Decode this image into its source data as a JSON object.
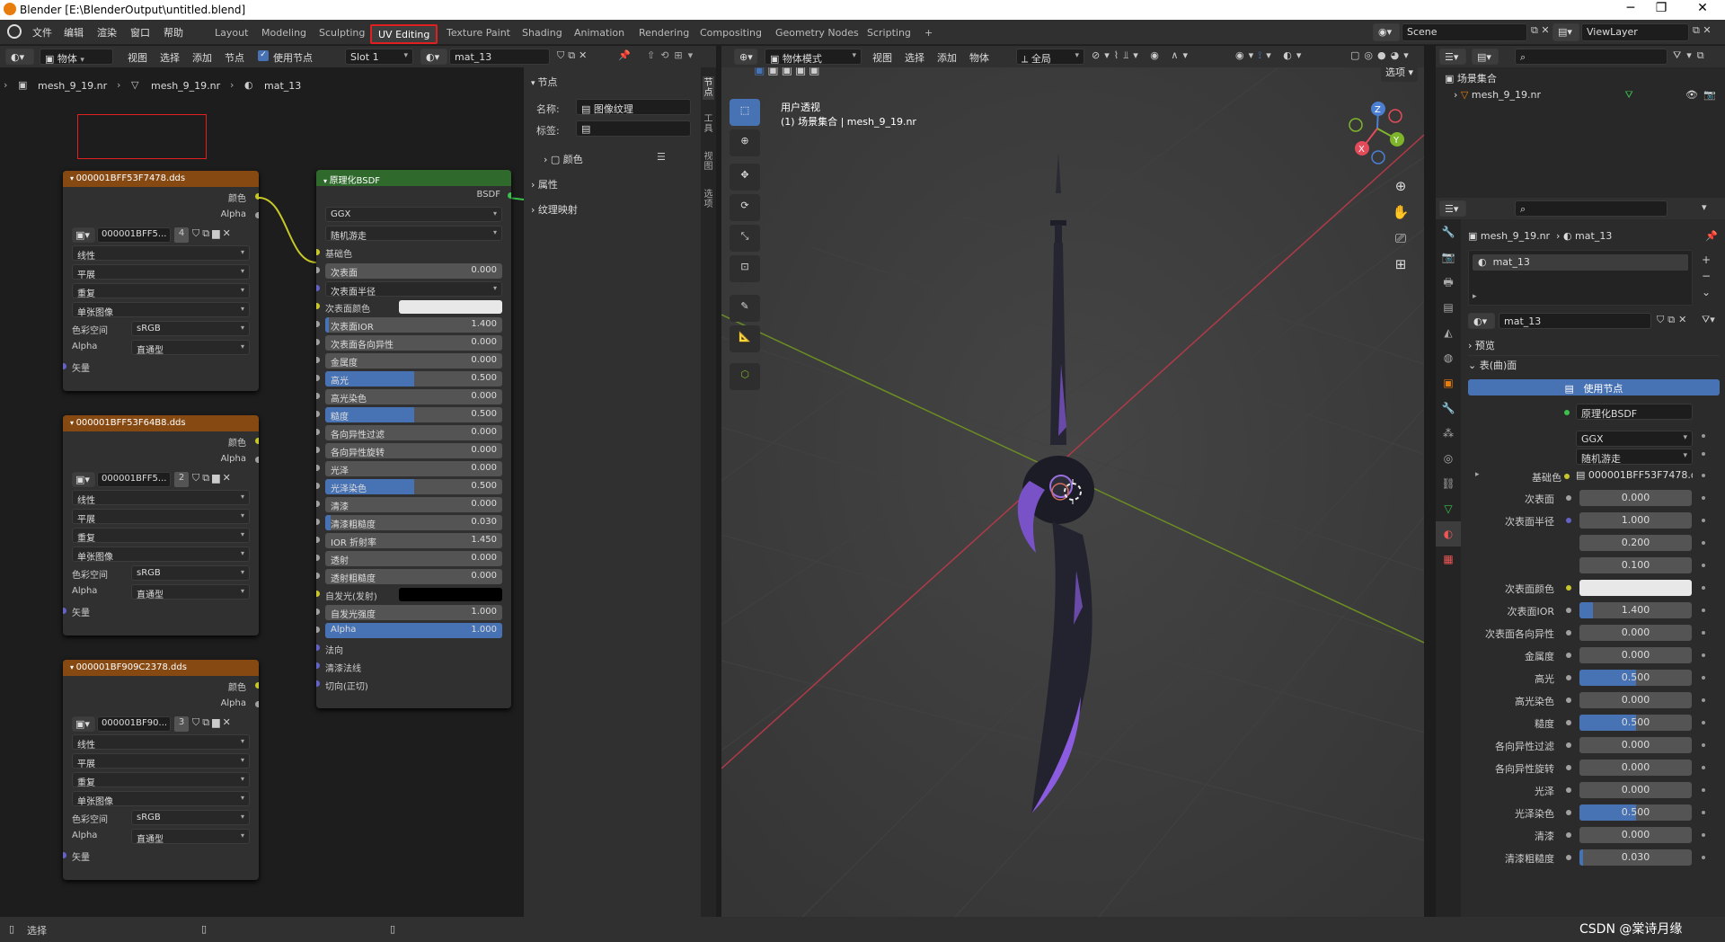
{
  "titlebar": {
    "title": "Blender [E:\\BlenderOutput\\untitled.blend]"
  },
  "menu": [
    "文件",
    "编辑",
    "渲染",
    "窗口",
    "帮助"
  ],
  "workspaces": [
    "Layout",
    "Modeling",
    "Sculpting",
    "UV Editing",
    "Texture Paint",
    "Shading",
    "Animation",
    "Rendering",
    "Compositing",
    "Geometry Nodes",
    "Scripting",
    "+"
  ],
  "active_workspace": "UV Editing",
  "scene": {
    "name": "Scene",
    "view_layer": "ViewLayer"
  },
  "node_header": {
    "mode": "物体",
    "menus": [
      "视图",
      "选择",
      "添加",
      "节点"
    ],
    "use_nodes": "使用节点",
    "slot": "Slot 1",
    "material": "mat_13"
  },
  "breadcrumb": [
    "mesh_9_19.nr",
    "mesh_9_19.nr",
    "mat_13"
  ],
  "image_nodes": [
    {
      "title": "000001BFF53F7478.dds",
      "img": "000001BFF5...",
      "users": "4",
      "interp": "线性",
      "proj": "平展",
      "ext": "重复",
      "src": "单张图像",
      "cs_label": "色彩空间",
      "cs": "sRGB",
      "alpha_label": "Alpha",
      "alpha": "直通型",
      "out_color": "颜色",
      "out_alpha": "Alpha",
      "in_vec": "矢量"
    },
    {
      "title": "000001BFF53F64B8.dds",
      "img": "000001BFF5...",
      "users": "2",
      "interp": "线性",
      "proj": "平展",
      "ext": "重复",
      "src": "单张图像",
      "cs_label": "色彩空间",
      "cs": "sRGB",
      "alpha_label": "Alpha",
      "alpha": "直通型",
      "out_color": "颜色",
      "out_alpha": "Alpha",
      "in_vec": "矢量"
    },
    {
      "title": "000001BF909C2378.dds",
      "img": "000001BF90...",
      "users": "3",
      "interp": "线性",
      "proj": "平展",
      "ext": "重复",
      "src": "单张图像",
      "cs_label": "色彩空间",
      "cs": "sRGB",
      "alpha_label": "Alpha",
      "alpha": "直通型",
      "out_color": "颜色",
      "out_alpha": "Alpha",
      "in_vec": "矢量"
    }
  ],
  "bsdf": {
    "title": "原理化BSDF",
    "output": "BSDF",
    "dist": "GGX",
    "sss_method": "随机游走",
    "base_color": "基础色",
    "fields": [
      {
        "label": "次表面",
        "value": "0.000",
        "fill": 0
      },
      {
        "label": "次表面半径",
        "type": "select"
      },
      {
        "label": "次表面颜色",
        "type": "color",
        "color": "#e8e8e8"
      },
      {
        "label": "次表面IOR",
        "value": "1.400",
        "fill": 0.02
      },
      {
        "label": "次表面各向异性",
        "value": "0.000",
        "fill": 0
      },
      {
        "label": "金属度",
        "value": "0.000",
        "fill": 0
      },
      {
        "label": "高光",
        "value": "0.500",
        "fill": 0.5
      },
      {
        "label": "高光染色",
        "value": "0.000",
        "fill": 0
      },
      {
        "label": "糙度",
        "value": "0.500",
        "fill": 0.5
      },
      {
        "label": "各向异性过滤",
        "value": "0.000",
        "fill": 0
      },
      {
        "label": "各向异性旋转",
        "value": "0.000",
        "fill": 0
      },
      {
        "label": "光泽",
        "value": "0.000",
        "fill": 0
      },
      {
        "label": "光泽染色",
        "value": "0.500",
        "fill": 0.5
      },
      {
        "label": "清漆",
        "value": "0.000",
        "fill": 0
      },
      {
        "label": "清漆粗糙度",
        "value": "0.030",
        "fill": 0.03
      },
      {
        "label": "IOR 折射率",
        "value": "1.450",
        "fill": 0
      },
      {
        "label": "透射",
        "value": "0.000",
        "fill": 0
      },
      {
        "label": "透射粗糙度",
        "value": "0.000",
        "fill": 0
      },
      {
        "label": "自发光(发射)",
        "type": "color",
        "color": "#000000"
      },
      {
        "label": "自发光强度",
        "value": "1.000",
        "fill": 0
      },
      {
        "label": "Alpha",
        "value": "1.000",
        "fill": 1
      }
    ],
    "inputs_tail": [
      "法向",
      "清漆法线",
      "切向(正切)"
    ]
  },
  "npanel": {
    "section_node": "节点",
    "name_label": "名称:",
    "name_value": "图像纹理",
    "label_label": "标签:",
    "color": "颜色",
    "props": "属性",
    "tex_map": "纹理映射",
    "tabs": [
      "节点",
      "工具",
      "视图",
      "选项"
    ]
  },
  "viewport_header": {
    "mode": "物体模式",
    "menus": [
      "视图",
      "选择",
      "添加",
      "物体"
    ],
    "orient": "全局",
    "options": "选项"
  },
  "viewport": {
    "line1": "用户透视",
    "line2": "(1) 场景集合 | mesh_9_19.nr"
  },
  "outliner": {
    "root": "场景集合",
    "item": "mesh_9_19.nr"
  },
  "props": {
    "breadcrumb": [
      "mesh_9_19.nr",
      "mat_13"
    ],
    "slot": "mat_13",
    "material": "mat_13",
    "preview": "预览",
    "surface_panel": "表(曲)面",
    "use_nodes": "使用节点",
    "surface_label": "表(曲)面",
    "surface_value": "原理化BSDF",
    "dist": "GGX",
    "sss_method": "随机游走",
    "base_color_label": "基础色",
    "base_color_value": "000001BFF53F7478.d...",
    "rows": [
      {
        "label": "次表面",
        "value": "0.000",
        "fill": 0,
        "dot": "#a1a1a1"
      },
      {
        "label": "次表面半径",
        "value": "1.000",
        "fill": 0,
        "dot": "#6363c7"
      },
      {
        "label": "",
        "value": "0.200",
        "fill": 0
      },
      {
        "label": "",
        "value": "0.100",
        "fill": 0
      },
      {
        "label": "次表面颜色",
        "type": "color",
        "dot": "#c7c729"
      },
      {
        "label": "次表面IOR",
        "value": "1.400",
        "fill": 0.12,
        "dot": "#a1a1a1"
      },
      {
        "label": "次表面各向异性",
        "value": "0.000",
        "fill": 0,
        "dot": "#a1a1a1"
      },
      {
        "label": "金属度",
        "value": "0.000",
        "fill": 0,
        "dot": "#a1a1a1"
      },
      {
        "label": "高光",
        "value": "0.500",
        "fill": 0.5,
        "dot": "#a1a1a1"
      },
      {
        "label": "高光染色",
        "value": "0.000",
        "fill": 0,
        "dot": "#a1a1a1"
      },
      {
        "label": "糙度",
        "value": "0.500",
        "fill": 0.5,
        "dot": "#a1a1a1"
      },
      {
        "label": "各向异性过滤",
        "value": "0.000",
        "fill": 0,
        "dot": "#a1a1a1"
      },
      {
        "label": "各向异性旋转",
        "value": "0.000",
        "fill": 0,
        "dot": "#a1a1a1"
      },
      {
        "label": "光泽",
        "value": "0.000",
        "fill": 0,
        "dot": "#a1a1a1"
      },
      {
        "label": "光泽染色",
        "value": "0.500",
        "fill": 0.5,
        "dot": "#a1a1a1"
      },
      {
        "label": "清漆",
        "value": "0.000",
        "fill": 0,
        "dot": "#a1a1a1"
      },
      {
        "label": "清漆粗糙度",
        "value": "0.030",
        "fill": 0.03,
        "dot": "#a1a1a1"
      }
    ]
  },
  "status": {
    "select": "选择",
    "watermark": "CSDN @棠诗月缘"
  },
  "colors": {
    "accent": "#4772b3",
    "image_node_header": "#874912",
    "bsdf_header": "#2f6a2c",
    "highlight_box": "#e02020"
  }
}
